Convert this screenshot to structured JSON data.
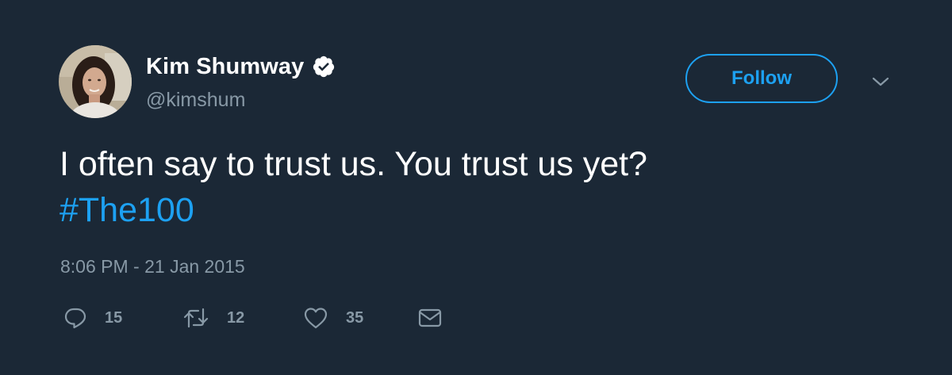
{
  "tweet": {
    "author": {
      "display_name": "Kim Shumway",
      "handle": "@kimshum",
      "verified": true,
      "avatar_icon": "user-avatar-photo"
    },
    "follow_label": "Follow",
    "text_line1": "I often say to trust us. You trust us yet?",
    "hashtag": "#The100",
    "timestamp": "8:06 PM - 21 Jan 2015",
    "actions": {
      "reply_count": "15",
      "retweet_count": "12",
      "like_count": "35"
    }
  },
  "theme": {
    "background": "#1b2836",
    "accent": "#1da1f2",
    "muted_text": "#8899a6",
    "text": "#ffffff"
  },
  "icons": [
    "verified-badge-icon",
    "chevron-down-icon",
    "reply-icon",
    "retweet-icon",
    "like-icon",
    "direct-message-icon"
  ]
}
